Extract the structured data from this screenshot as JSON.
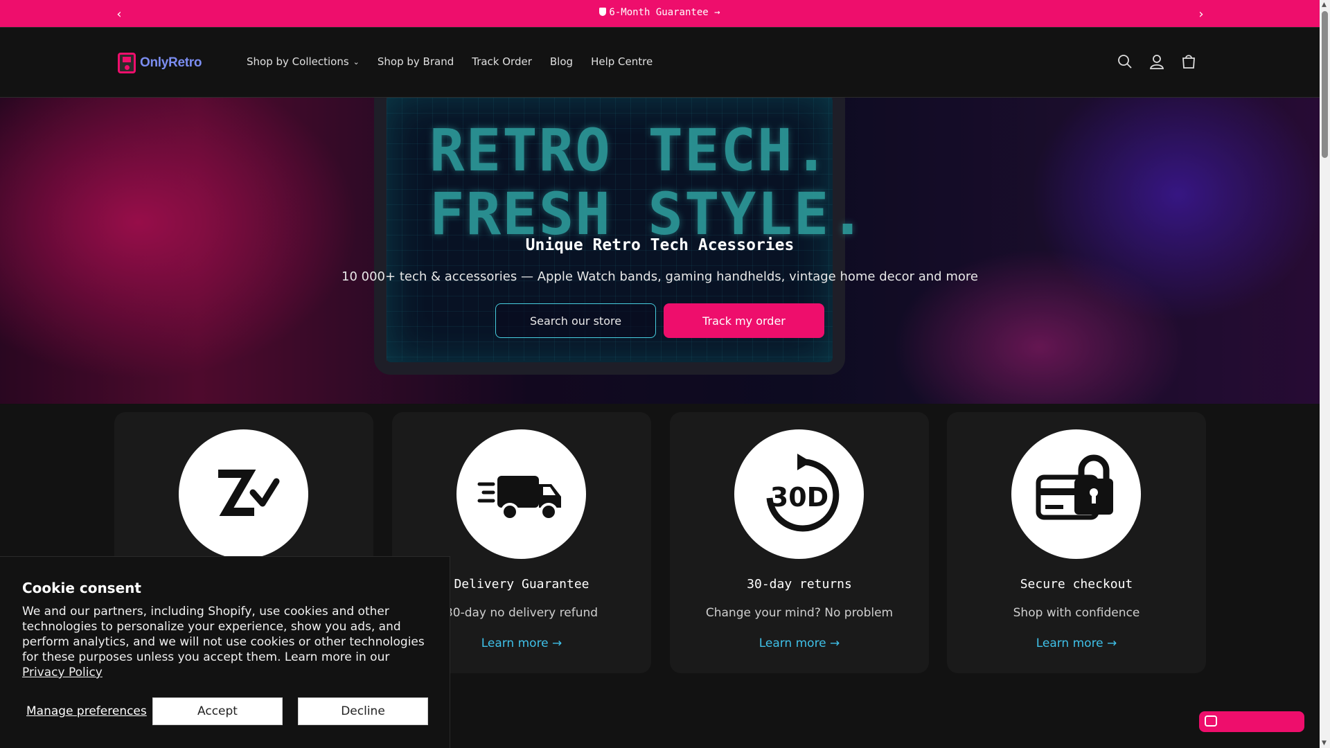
{
  "announcement": {
    "message": "6-Month Guarantee",
    "arrow": "→",
    "prev_icon": "chevron-left-icon",
    "next_icon": "chevron-right-icon"
  },
  "header": {
    "logo_text": "OnlyRetro",
    "nav": [
      {
        "label": "Shop by Collections",
        "has_dropdown": true
      },
      {
        "label": "Shop by Brand"
      },
      {
        "label": "Track Order"
      },
      {
        "label": "Blog"
      },
      {
        "label": "Help Centre"
      }
    ],
    "icons": [
      "search-icon",
      "account-icon",
      "cart-icon"
    ]
  },
  "hero": {
    "screen_text_line1": "RETRO TECH.",
    "screen_text_line2": "FRESH STYLE.",
    "title": "Unique Retro Tech Acessories",
    "subtitle": "10 000+ tech & accessories — Apple Watch bands, gaming handhelds, vintage home decor and more",
    "btn_search": "Search our store",
    "btn_track": "Track my order"
  },
  "features": [
    {
      "icon": "zip-pay-icon",
      "title": "",
      "desc": "",
      "link": ""
    },
    {
      "icon": "delivery-truck-icon",
      "title": "Delivery Guarantee",
      "desc": "30-day no delivery refund",
      "link": "Learn more →"
    },
    {
      "icon": "30-day-returns-icon",
      "title": "30-day returns",
      "desc": "Change your mind? No problem",
      "link": "Learn more →"
    },
    {
      "icon": "secure-checkout-icon",
      "title": "Secure checkout",
      "desc": "Shop with confidence",
      "link": "Learn more →"
    }
  ],
  "cookie": {
    "title": "Cookie consent",
    "body": "We and our partners, including Shopify, use cookies and other technologies to personalize your experience, show you ads, and perform analytics, and we will not use cookies or other technologies for these purposes unless you accept them. Learn more in our ",
    "policy_link": "Privacy Policy",
    "manage": "Manage preferences",
    "accept": "Accept",
    "decline": "Decline"
  },
  "colors": {
    "brand_pink": "#ee0e6c",
    "accent_cyan": "#3fc0e8",
    "background": "#121212"
  }
}
